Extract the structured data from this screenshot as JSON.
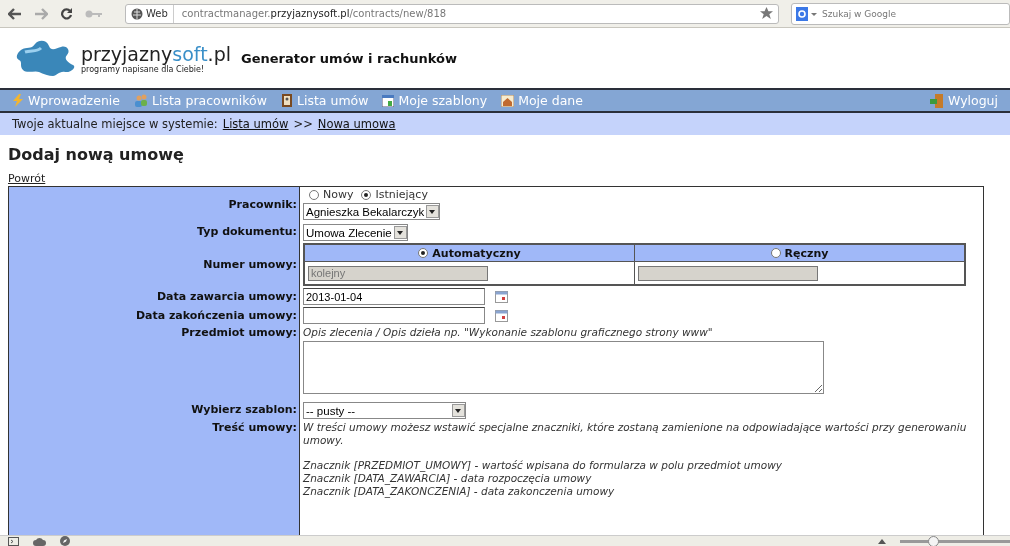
{
  "browser": {
    "site_chip": "Web",
    "address": "contractmanager.**przyjaznysoft.pl**/contracts/new/818",
    "search": {
      "placeholder": "Szukaj w Google"
    },
    "zoom": {
      "level": 0.3
    }
  },
  "header": {
    "logo_name": [
      "przyjazny",
      "soft",
      ".pl"
    ],
    "tagline": "programy napisane dla Ciebie!",
    "app_title": "Generator umów i rachunków"
  },
  "nav": {
    "items": [
      {
        "label": "Wprowadzenie"
      },
      {
        "label": "Lista pracowników"
      },
      {
        "label": "Lista umów"
      },
      {
        "label": "Moje szablony"
      },
      {
        "label": "Moje dane"
      }
    ],
    "logout": "Wyloguj"
  },
  "breadcrumb": {
    "prefix": "Twoje aktualne miejsce w systemie:",
    "links": [
      "Lista umów",
      "Nowa umowa"
    ],
    "separator": ">>"
  },
  "page_title": "Dodaj nową umowę",
  "back_link": "Powrót",
  "form": [
    {
      "kind": "employee",
      "label": "Pracownik:",
      "options": [
        {
          "label": "Nowy",
          "selected": false
        },
        {
          "label": "Istniejący",
          "selected": true
        }
      ],
      "value": "Agnieszka Bekalarczyk"
    },
    {
      "kind": "select",
      "label": "Typ dokumentu:",
      "value": "Umowa Zlecenie"
    },
    {
      "kind": "number",
      "label": "Numer umowy:",
      "modes": [
        {
          "label": "Automatyczny",
          "selected": true,
          "placeholder": "kolejny",
          "disabled": true
        },
        {
          "label": "Ręczny",
          "selected": false,
          "disabled": true
        }
      ]
    },
    {
      "kind": "date",
      "label": "Data zawarcia umowy:",
      "value": "2013-01-04"
    },
    {
      "kind": "date",
      "label": "Data zakończenia umowy:"
    },
    {
      "kind": "textarea",
      "label": "Przedmiot umowy:",
      "hint": "Opis zlecenia / Opis dzieła np. \"Wykonanie szablonu graficznego strony www\""
    },
    {
      "kind": "wideselect",
      "label": "Wybierz szablon:",
      "value": "-- pusty --"
    },
    {
      "kind": "text",
      "label": "Treść umowy:",
      "intro": "W treści umowy możesz wstawić specjalne znaczniki, które zostaną zamienione na odpowiadające wartości przy generowaniu umowy.",
      "lines": [
        "Znacznik [PRZEDMIOT_UMOWY] - wartość wpisana do formularza w polu przedmiot umowy",
        "Znacznik [DATA_ZAWARCIA] - data rozpoczęcia umowy",
        "Znacznik [DATA_ZAKONCZENIA] - data zakonczenia umowy"
      ]
    }
  ]
}
